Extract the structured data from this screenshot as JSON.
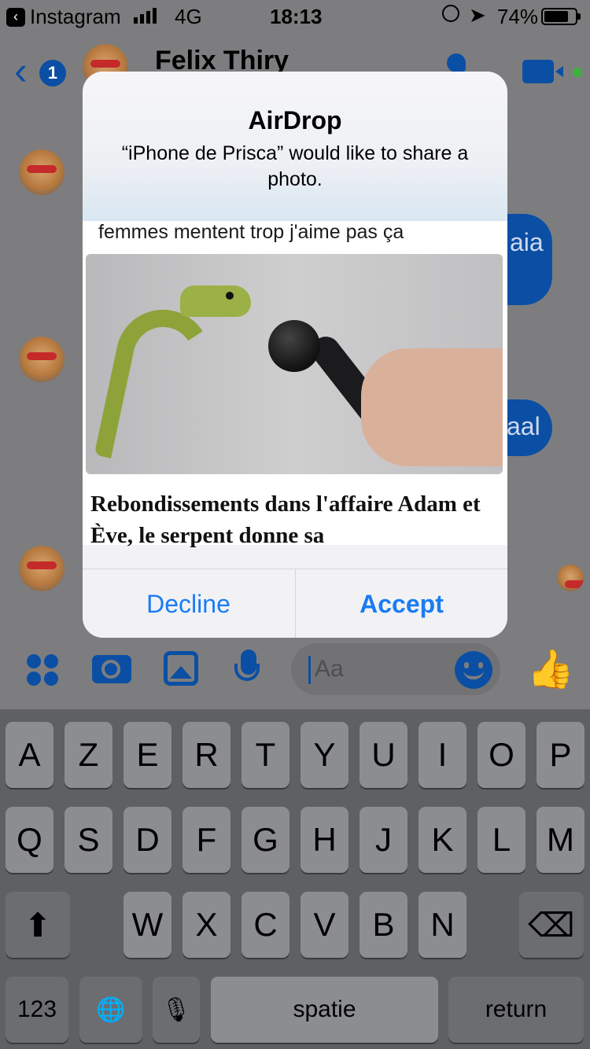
{
  "status_bar": {
    "back_app": "Instagram",
    "network": "4G",
    "time": "18:13",
    "battery": "74%"
  },
  "header": {
    "unread_count": "1",
    "contact_name": "Felix Thiry"
  },
  "chat": {
    "bubble_1_fragment": "aia",
    "bubble_2_fragment": "aal"
  },
  "composer": {
    "placeholder": "Aa"
  },
  "airdrop": {
    "title": "AirDrop",
    "message": "“iPhone de Prisca” would like to share a photo.",
    "preview_caption": "femmes mentent trop j'aime pas ça",
    "preview_headline": "Rebondissements dans l'affaire Adam et Ève, le serpent donne sa",
    "decline": "Decline",
    "accept": "Accept"
  },
  "keyboard": {
    "row1": [
      "A",
      "Z",
      "E",
      "R",
      "T",
      "Y",
      "U",
      "I",
      "O",
      "P"
    ],
    "row2": [
      "Q",
      "S",
      "D",
      "F",
      "G",
      "H",
      "J",
      "K",
      "L",
      "M"
    ],
    "row3": [
      "W",
      "X",
      "C",
      "V",
      "B",
      "N"
    ],
    "numbers": "123",
    "space": "spatie",
    "return": "return"
  },
  "colors": {
    "messenger_blue": "#0b4fa4",
    "ios_blue": "#1a7cf5",
    "dimmed_background": "#7d7d7f"
  }
}
